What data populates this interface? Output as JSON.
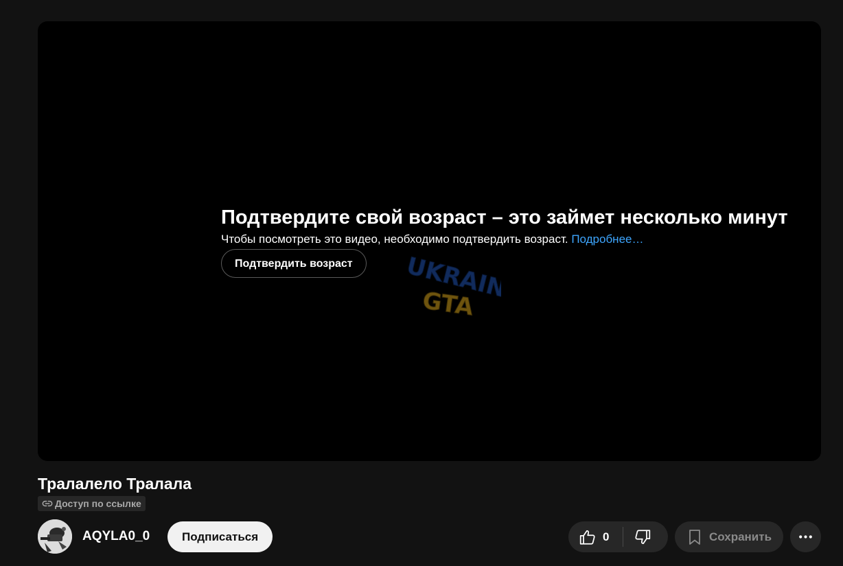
{
  "player": {
    "age_gate": {
      "title": "Подтвердите свой возраст – это займет несколько минут",
      "description": "Чтобы посмотреть это видео, необходимо подтвердить возраст.",
      "link_label": "Подробнее…",
      "confirm_button_label": "Подтвердить возраст"
    },
    "watermark_text": [
      "UKRAINE",
      "GTA"
    ]
  },
  "video": {
    "title": "Тралалело Тралала",
    "access_badge": "Доступ по ссылке"
  },
  "channel": {
    "name": "AQYLA0_0",
    "subscribe_label": "Подписаться"
  },
  "actions": {
    "like_count": "0",
    "save_label": "Сохранить"
  },
  "icons": {
    "access": "link-icon",
    "like": "thumbs-up-icon",
    "dislike": "thumbs-down-icon",
    "save": "bookmark-icon",
    "more": "more-horizontal-icon"
  },
  "colors": {
    "background": "#121212",
    "player_background": "#000000",
    "link": "#3ea6ff",
    "chip_background": "#272727",
    "subscribe_background": "#f1f1f1",
    "watermark_blue": "#1f4fa8",
    "watermark_yellow": "#c99a1a"
  }
}
